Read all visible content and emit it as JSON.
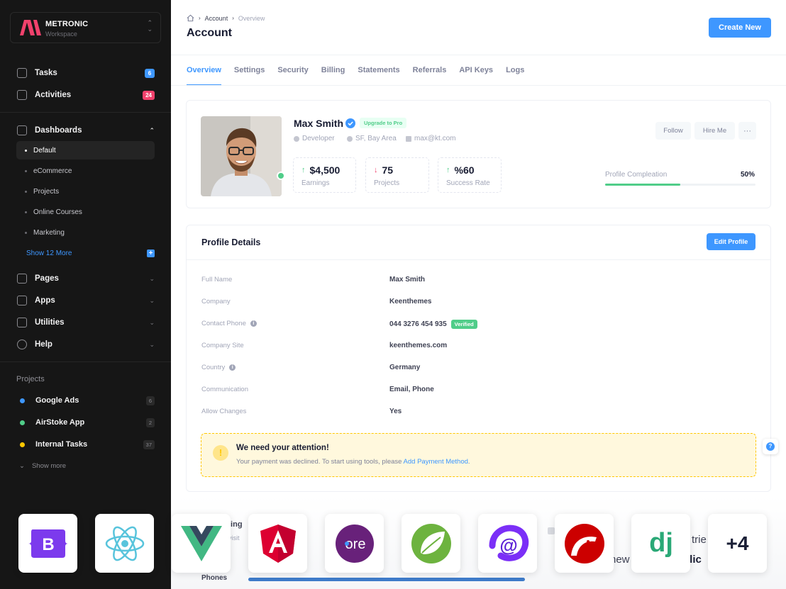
{
  "workspace": {
    "name": "METRONIC",
    "sub": "Workspace"
  },
  "sidebar": {
    "top_items": [
      {
        "label": "Tasks",
        "badge": "6",
        "badge_color": "#3e97ff"
      },
      {
        "label": "Activities",
        "badge": "24",
        "badge_color": "#f1416c"
      }
    ],
    "dashboards": {
      "label": "Dashboards",
      "children": [
        "Default",
        "eCommerce",
        "Projects",
        "Online Courses",
        "Marketing"
      ],
      "show_more": "Show 12 More"
    },
    "groups": [
      "Pages",
      "Apps",
      "Utilities",
      "Help"
    ],
    "projects_title": "Projects",
    "projects": [
      {
        "label": "Google Ads",
        "count": "6",
        "color": "#3e97ff"
      },
      {
        "label": "AirStoke App",
        "count": "2",
        "color": "#50cd89"
      },
      {
        "label": "Internal Tasks",
        "count": "37",
        "color": "#ffc700"
      }
    ],
    "show_more": "Show more"
  },
  "header": {
    "breadcrumb": [
      "Account",
      "Overview"
    ],
    "title": "Account",
    "create_button": "Create New"
  },
  "tabs": [
    "Overview",
    "Settings",
    "Security",
    "Billing",
    "Statements",
    "Referrals",
    "API Keys",
    "Logs"
  ],
  "profile": {
    "name": "Max Smith",
    "pro_badge": "Upgrade to Pro",
    "role": "Developer",
    "location": "SF, Bay Area",
    "email": "max@kt.com",
    "stats": [
      {
        "value": "$4,500",
        "label": "Earnings",
        "trend": "up"
      },
      {
        "value": "75",
        "label": "Projects",
        "trend": "down"
      },
      {
        "value": "%60",
        "label": "Success Rate",
        "trend": "up"
      }
    ],
    "follow_button": "Follow",
    "hire_button": "Hire Me",
    "more_button": "···",
    "completion_label": "Profile Compleation",
    "completion_value": "50%",
    "completion_fraction": 0.5
  },
  "details": {
    "title": "Profile Details",
    "edit_button": "Edit Profile",
    "rows": [
      {
        "label": "Full Name",
        "value": "Max Smith"
      },
      {
        "label": "Company",
        "value": "Keenthemes"
      },
      {
        "label": "Contact Phone",
        "value": "044 3276 454 935",
        "tag": "Verified"
      },
      {
        "label": "Company Site",
        "value": "keenthemes.com"
      },
      {
        "label": "Country",
        "value": "Germany"
      },
      {
        "label": "Communication",
        "value": "Email, Phone"
      },
      {
        "label": "Allow Changes",
        "value": "Yes"
      }
    ]
  },
  "notice": {
    "title": "We need your attention!",
    "text": "Your payment was declined. To start using tools, please ",
    "link": "Add Payment Method",
    "tail": "."
  },
  "background_fragments": {
    "a": "ling",
    "b": "visit",
    "c": "trie",
    "d": "new",
    "e": "plic",
    "f": "Phones"
  },
  "frameworks": [
    "bootstrap-icon",
    "react-icon",
    "vue-icon",
    "angular-icon",
    "dotnet-core-icon",
    "spring-icon",
    "blazor-icon",
    "rails-icon",
    "django-icon"
  ],
  "frameworks_more": "+4"
}
